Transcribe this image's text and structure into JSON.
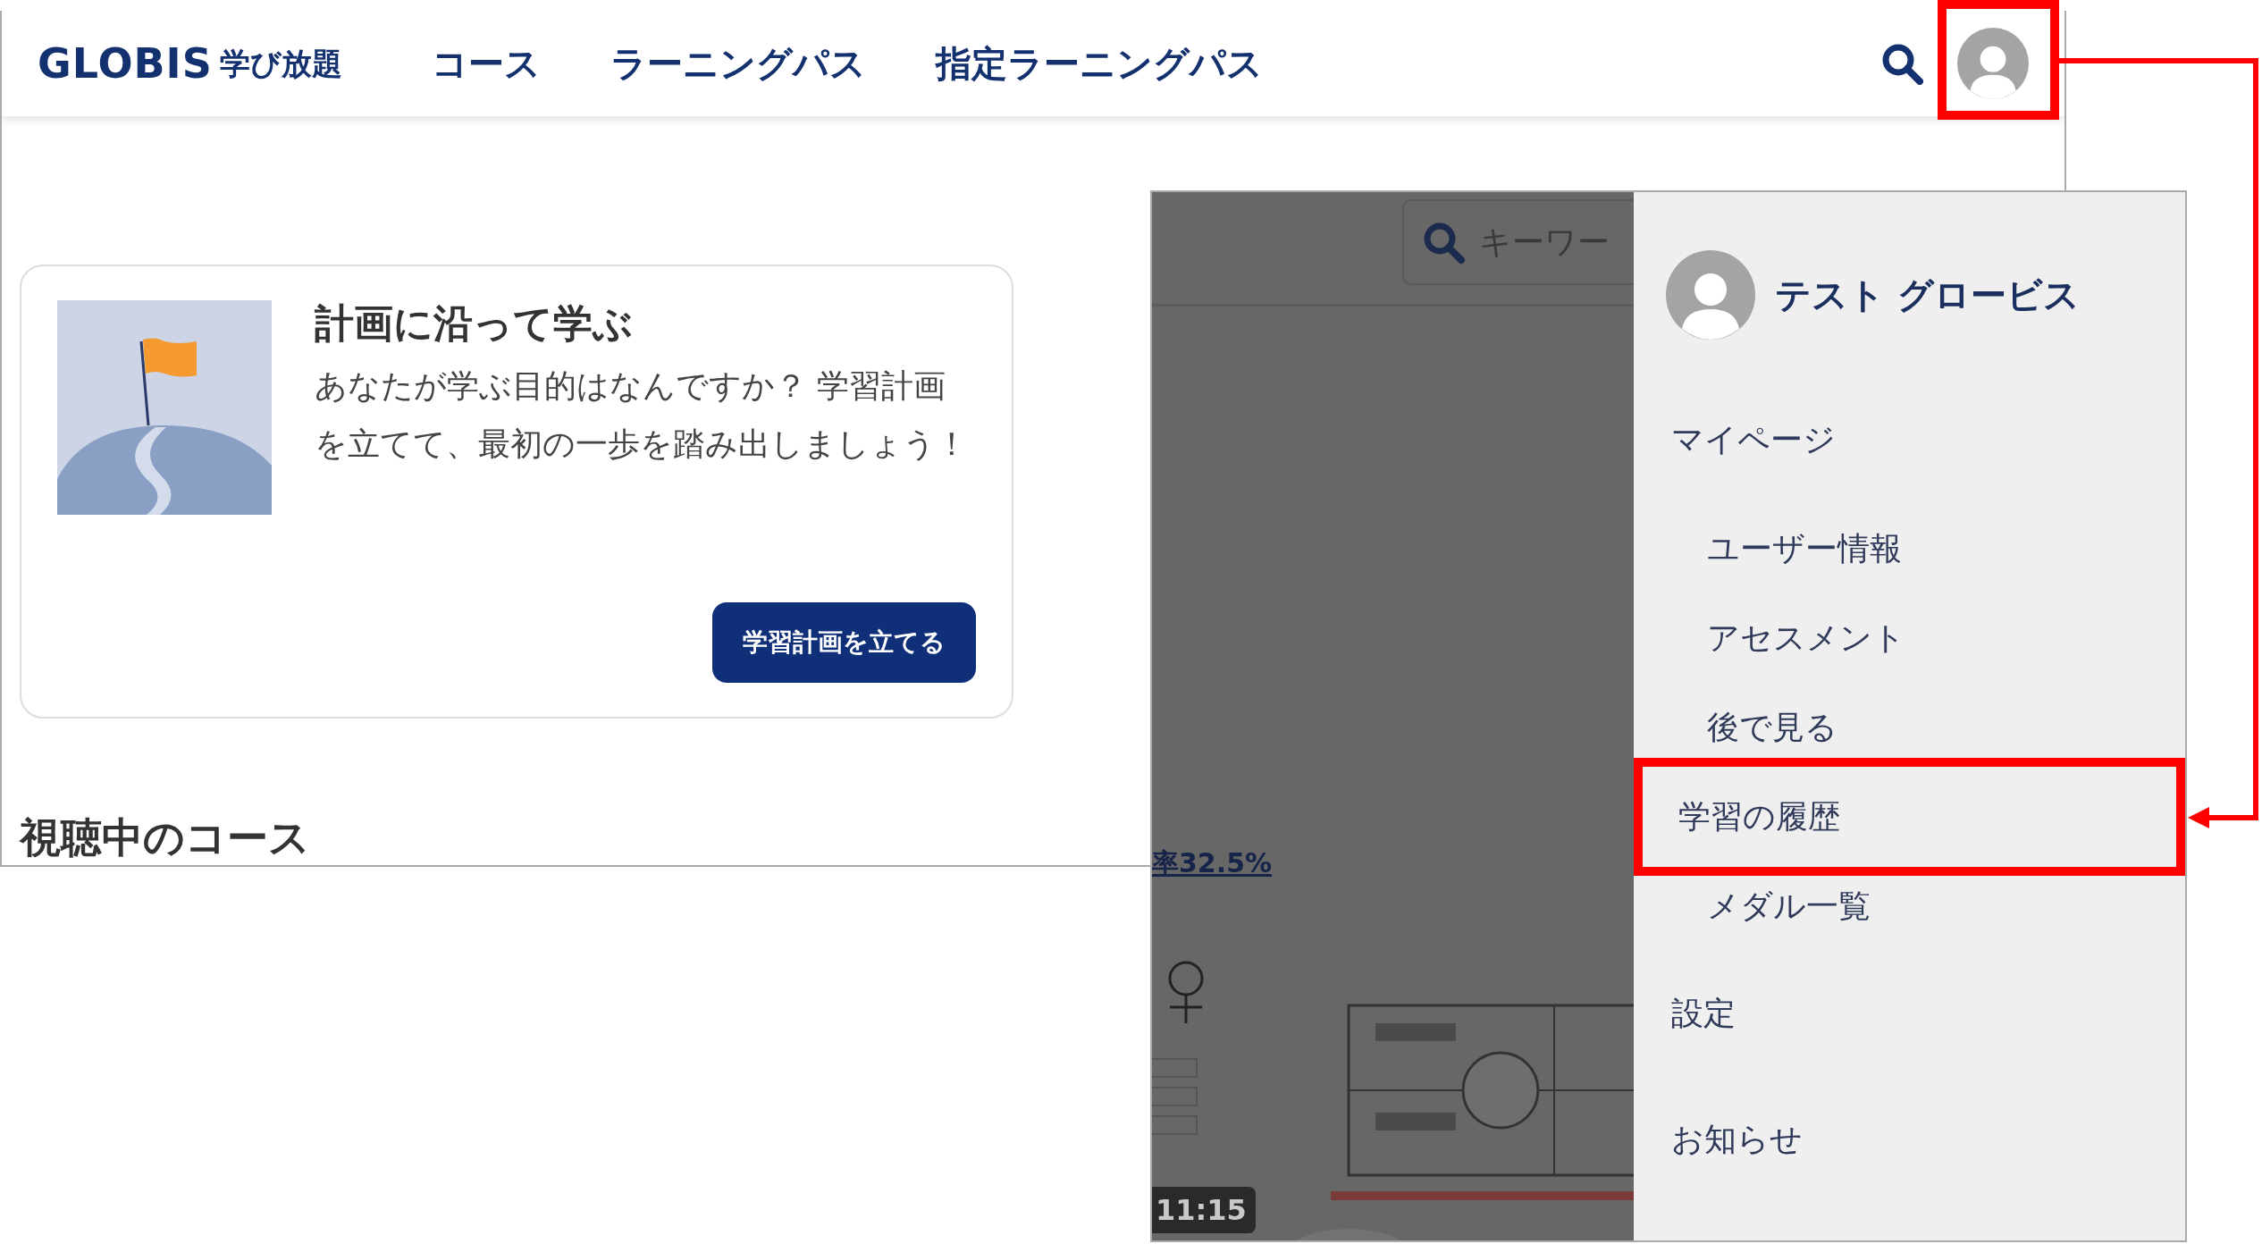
{
  "header": {
    "logo": "GLOBIS",
    "logo_tagline": "学び放題",
    "nav": [
      {
        "label": "コース"
      },
      {
        "label": "ラーニングパス"
      },
      {
        "label": "指定ラーニングパス"
      }
    ],
    "avatar_highlighted": true
  },
  "plan_card": {
    "title": "計画に沿って学ぶ",
    "body": "あなたが学ぶ目的はなんですか？ 学習計画を立てて、最初の一歩を踏み出しましょう！",
    "button": "学習計画を立てる"
  },
  "section_heading": "視聴中のコース",
  "menu_screenshot": {
    "search_placeholder": "キーワー",
    "progress_link": "率32.5%",
    "video_duration": "11:15",
    "user_name": "テスト グロービス",
    "items": [
      {
        "label": "マイページ",
        "highlighted": false,
        "children": [
          {
            "label": "ユーザー情報",
            "highlighted": false
          },
          {
            "label": "アセスメント",
            "highlighted": false
          },
          {
            "label": "後で見る",
            "highlighted": false
          },
          {
            "label": "学習の履歴",
            "highlighted": true
          },
          {
            "label": "メダル一覧",
            "highlighted": false
          }
        ]
      },
      {
        "label": "設定",
        "highlighted": false
      },
      {
        "label": "お知らせ",
        "highlighted": false
      }
    ]
  }
}
